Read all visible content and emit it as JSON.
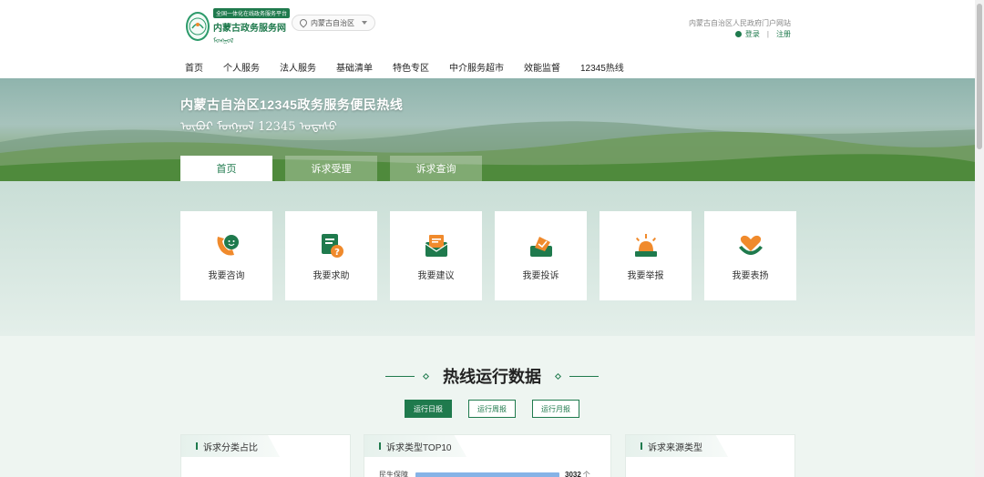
{
  "header": {
    "logo_badge": "全国一体化在线政务服务平台",
    "logo_title": "内蒙古政务服务网",
    "logo_mongol": "ᠮᠣᠩᠭᠤᠯ",
    "region": "内蒙古自治区",
    "portal_link": "内蒙古自治区人民政府门户网站",
    "login": "登录",
    "register": "注册"
  },
  "nav": [
    "首页",
    "个人服务",
    "法人服务",
    "基础清单",
    "特色专区",
    "中介服务超市",
    "效能监督",
    "12345热线"
  ],
  "banner": {
    "title": "内蒙古自治区12345政务服务便民热线",
    "subtitle": "ᠦᠪᠦᠷ ᠮᠣᠩᠭᠤᠯ 12345 ᠤᠲᠠᠰᠤ"
  },
  "tabs": [
    {
      "label": "首页",
      "active": true
    },
    {
      "label": "诉求受理",
      "active": false
    },
    {
      "label": "诉求查询",
      "active": false
    }
  ],
  "services": [
    {
      "label": "我要咨询",
      "icon": "consult-icon"
    },
    {
      "label": "我要求助",
      "icon": "help-icon"
    },
    {
      "label": "我要建议",
      "icon": "suggest-icon"
    },
    {
      "label": "我要投诉",
      "icon": "complain-icon"
    },
    {
      "label": "我要举报",
      "icon": "report-icon"
    },
    {
      "label": "我要表扬",
      "icon": "praise-icon"
    }
  ],
  "stats": {
    "title": "热线运行数据",
    "ranges": [
      {
        "label": "运行日报",
        "active": true
      },
      {
        "label": "运行周报",
        "active": false
      },
      {
        "label": "运行月报",
        "active": false
      }
    ],
    "panels": [
      {
        "title": "诉求分类占比"
      },
      {
        "title": "诉求类型TOP10",
        "first_item": {
          "label": "民生保障",
          "value": "3032",
          "unit": "个"
        }
      },
      {
        "title": "诉求来源类型"
      }
    ]
  },
  "colors": {
    "primary": "#1f7a4d",
    "accent": "#f08a2c",
    "bar": "#86b3e6"
  }
}
